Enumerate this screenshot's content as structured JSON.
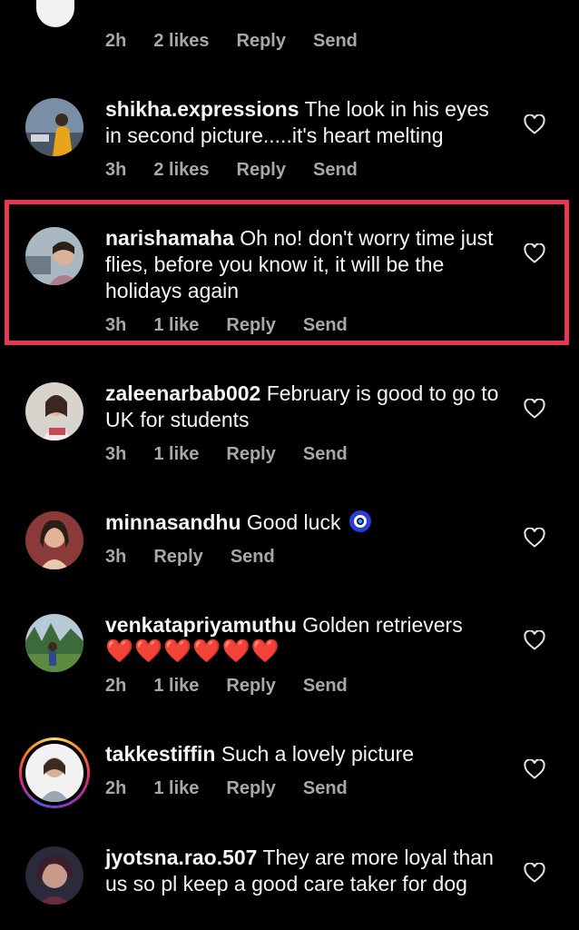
{
  "top_partial": {
    "time": "2h",
    "likes": "2 likes",
    "reply": "Reply",
    "send": "Send"
  },
  "comments": [
    {
      "username": "shikha.expressions",
      "text": "The look in his eyes in second picture.....it's heart melting",
      "time": "3h",
      "likes": "2 likes",
      "reply": "Reply",
      "send": "Send"
    },
    {
      "username": "narishamaha",
      "text": "Oh no! don't worry time just flies, before you know it, it will be the holidays again",
      "time": "3h",
      "likes": "1 like",
      "reply": "Reply",
      "send": "Send"
    },
    {
      "username": "zaleenarbab002",
      "text": "February is good to go to UK for students",
      "time": "3h",
      "likes": "1 like",
      "reply": "Reply",
      "send": "Send"
    },
    {
      "username": "minnasandhu",
      "text": "Good luck",
      "emoji": "nazar-amulet-icon",
      "time": "3h",
      "reply": "Reply",
      "send": "Send"
    },
    {
      "username": "venkatapriyamuthu",
      "text": "Golden retrievers",
      "emoji_text": "❤️❤️❤️❤️❤️❤️",
      "time": "2h",
      "likes": "1 like",
      "reply": "Reply",
      "send": "Send"
    },
    {
      "username": "takkestiffin",
      "text": "Such a lovely picture",
      "time": "2h",
      "likes": "1 like",
      "reply": "Reply",
      "send": "Send"
    },
    {
      "username": "jyotsna.rao.507",
      "text": "They are more loyal than us so pl keep a good care taker for dog"
    }
  ],
  "colors": {
    "background": "#000000",
    "highlight_border": "#e8384f",
    "meta_text": "#a8a8a8"
  }
}
